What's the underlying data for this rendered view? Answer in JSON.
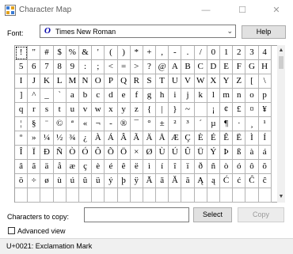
{
  "window": {
    "title": "Character Map",
    "minimize_glyph": "—",
    "maximize_glyph": "☐",
    "close_glyph": "✕"
  },
  "font": {
    "label": "Font:",
    "value": "Times New Roman",
    "truetype_glyph": "O",
    "help_label": "Help"
  },
  "grid": {
    "rows": [
      [
        "!",
        "\"",
        "#",
        "$",
        "%",
        "&",
        "'",
        "(",
        ")",
        "*",
        "+",
        ",",
        "-",
        ".",
        "/",
        "0",
        "1",
        "2",
        "3",
        "4"
      ],
      [
        "5",
        "6",
        "7",
        "8",
        "9",
        ":",
        ";",
        "<",
        "=",
        ">",
        "?",
        "@",
        "A",
        "B",
        "C",
        "D",
        "E",
        "F",
        "G",
        "H"
      ],
      [
        "I",
        "J",
        "K",
        "L",
        "M",
        "N",
        "O",
        "P",
        "Q",
        "R",
        "S",
        "T",
        "U",
        "V",
        "W",
        "X",
        "Y",
        "Z",
        "[",
        "\\"
      ],
      [
        "]",
        "^",
        "_",
        "`",
        "a",
        "b",
        "c",
        "d",
        "e",
        "f",
        "g",
        "h",
        "i",
        "j",
        "k",
        "l",
        "m",
        "n",
        "o",
        "p"
      ],
      [
        "q",
        "r",
        "s",
        "t",
        "u",
        "v",
        "w",
        "x",
        "y",
        "z",
        "{",
        "|",
        "}",
        "~",
        " ",
        "¡",
        "¢",
        "£",
        "¤",
        "¥"
      ],
      [
        "¦",
        "§",
        "¨",
        "©",
        "ª",
        "«",
        "¬",
        "-",
        "®",
        "¯",
        "°",
        "±",
        "²",
        "³",
        "´",
        "µ",
        "¶",
        "·",
        "¸",
        "¹"
      ],
      [
        "º",
        "»",
        "¼",
        "½",
        "¾",
        "¿",
        "À",
        "Á",
        "Â",
        "Ã",
        "Ä",
        "Å",
        "Æ",
        "Ç",
        "È",
        "É",
        "Ê",
        "Ë",
        "Ì",
        "Í"
      ],
      [
        "Î",
        "Ï",
        "Ð",
        "Ñ",
        "Ò",
        "Ó",
        "Ô",
        "Õ",
        "Ö",
        "×",
        "Ø",
        "Ù",
        "Ú",
        "Û",
        "Ü",
        "Ý",
        "Þ",
        "ß",
        "à",
        "á"
      ],
      [
        "â",
        "ã",
        "ä",
        "å",
        "æ",
        "ç",
        "è",
        "é",
        "ê",
        "ë",
        "ì",
        "í",
        "î",
        "ï",
        "ð",
        "ñ",
        "ò",
        "ó",
        "ô",
        "õ"
      ],
      [
        "ö",
        "÷",
        "ø",
        "ù",
        "ú",
        "û",
        "ü",
        "ý",
        "þ",
        "ÿ",
        "Ā",
        "ā",
        "Ă",
        "ă",
        "Ą",
        "ą",
        "Ć",
        "ć",
        "Ĉ",
        "ĉ"
      ]
    ],
    "selected": "!"
  },
  "scrollbar": {
    "up_glyph": "▲",
    "down_glyph": "▼"
  },
  "copy": {
    "label": "Characters to copy:",
    "value": "",
    "select_label": "Select",
    "copy_label": "Copy"
  },
  "advanced": {
    "label": "Advanced view",
    "checked": false
  },
  "status": {
    "text": "U+0021: Exclamation Mark"
  },
  "colors": {
    "accent": "#0078d7",
    "titlebar_text": "#5e5e5e",
    "disabled_text": "#9a9a9a",
    "grid_line": "#b4b4b4"
  }
}
